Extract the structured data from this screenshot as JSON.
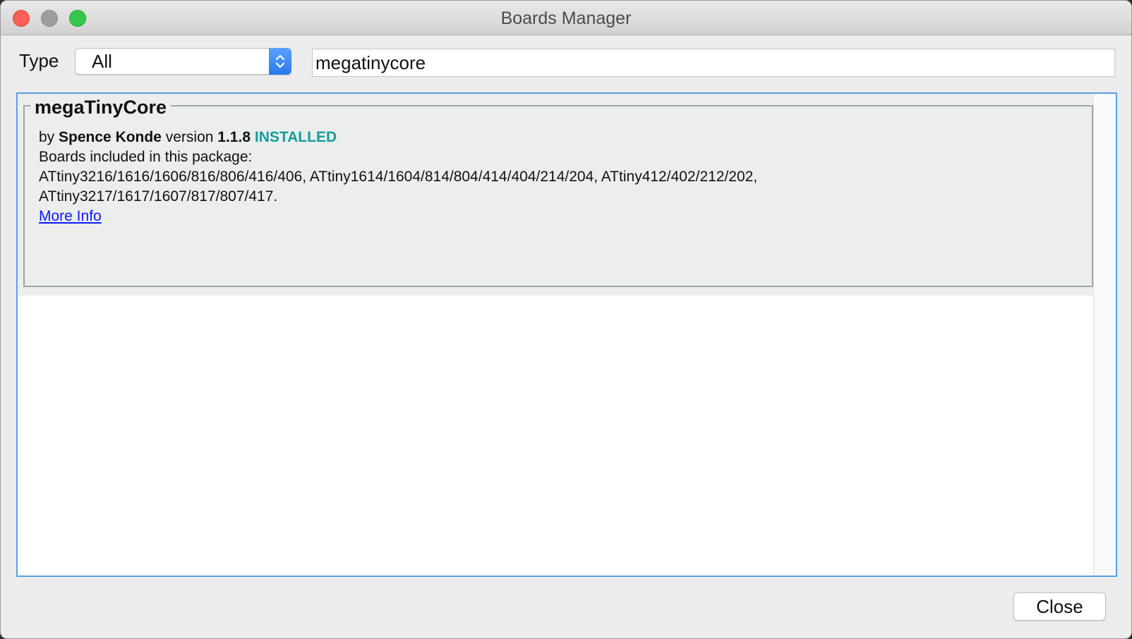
{
  "window": {
    "title": "Boards Manager"
  },
  "filter": {
    "type_label": "Type",
    "type_value": "All",
    "search_value": "megatinycore"
  },
  "package": {
    "name": "megaTinyCore",
    "by_prefix": "by",
    "author": "Spence Konde",
    "version_prefix": "version",
    "version": "1.1.8",
    "status": "INSTALLED",
    "boards_heading": "Boards included in this package:",
    "boards_line1": "ATtiny3216/1616/1606/816/806/416/406, ATtiny1614/1604/814/804/414/404/214/204, ATtiny412/402/212/202,",
    "boards_line2": "ATtiny3217/1617/1607/817/807/417.",
    "more_info_label": "More Info"
  },
  "footer": {
    "close_label": "Close"
  },
  "colors": {
    "installed": "#169c9c",
    "link": "#0d1aff",
    "focus_border": "#5c9ee6"
  }
}
